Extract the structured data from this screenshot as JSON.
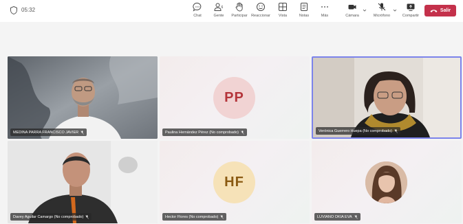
{
  "meeting": {
    "timer": "05:32"
  },
  "toolbar": {
    "chat": "Chat",
    "people": "Gente",
    "raise": "Participar",
    "react": "Reaccionar",
    "view": "Vista",
    "notes": "Notas",
    "more": "Más",
    "camera": "Cámara",
    "mic": "Micrófono",
    "share": "Compartir",
    "leave": "Salir"
  },
  "participants": [
    {
      "name": "MEDINA PARRA FRANCISCO JAVIER",
      "type": "video"
    },
    {
      "name": "Paulina Hernández Pérez (No comprobado)",
      "initials": "PP",
      "type": "initials"
    },
    {
      "name": "Verónica Guerrero Huepa (No comprobado)",
      "type": "video",
      "active": true
    },
    {
      "name": "Davey Aguilar Camargo (No comprobado)",
      "type": "video"
    },
    {
      "name": "Hector Flores (No comprobado)",
      "initials": "HF",
      "type": "initials"
    },
    {
      "name": "LUVIANO OKIA EVA",
      "type": "photo"
    }
  ],
  "colors": {
    "leave": "#c4314b",
    "active_border": "#7b83eb"
  }
}
